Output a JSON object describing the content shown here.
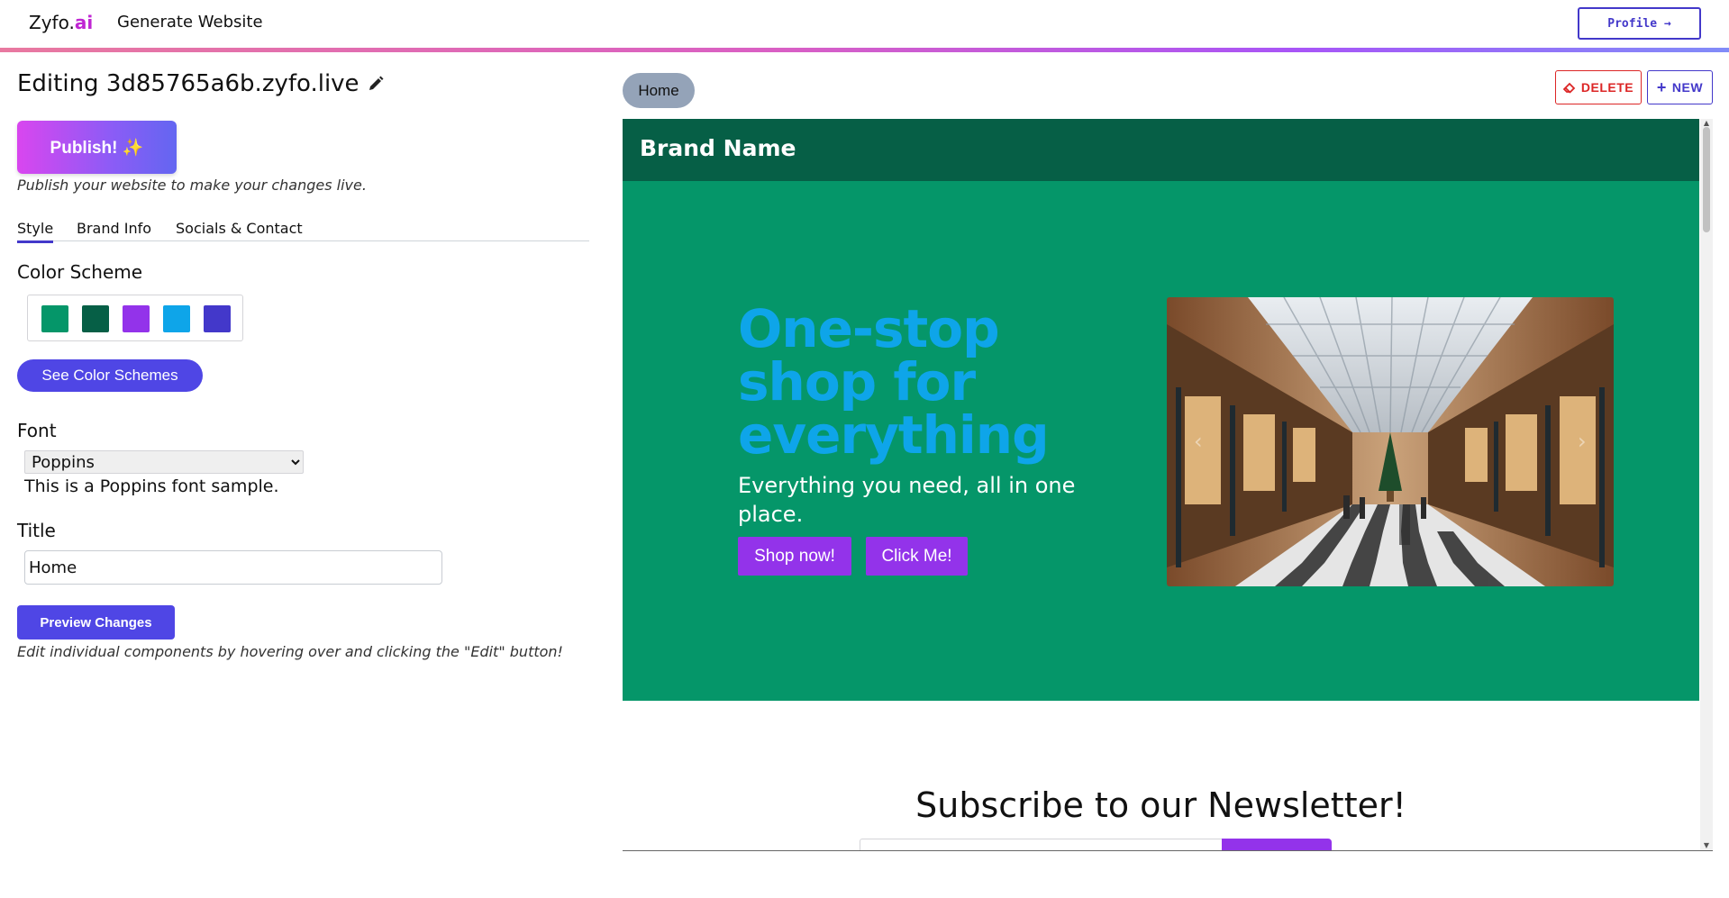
{
  "nav": {
    "logo_main": "Zyfo.",
    "logo_accent": "ai",
    "generate_link": "Generate Website",
    "profile_label": "Profile →"
  },
  "editor": {
    "title": "Editing 3d85765a6b.zyfo.live",
    "publish_label": "Publish! ✨",
    "publish_hint": "Publish your website to make your changes live.",
    "tabs": [
      "Style",
      "Brand Info",
      "Socials & Contact"
    ],
    "active_tab": "Style",
    "color_scheme_label": "Color Scheme",
    "color_scheme": [
      "#059669",
      "#065f46",
      "#9333ea",
      "#0ea5e9",
      "#4338ca"
    ],
    "see_schemes_label": "See Color Schemes",
    "font_label": "Font",
    "font_value": "Poppins",
    "font_sample": "This is a Poppins font sample.",
    "title_label": "Title",
    "title_value": "Home",
    "preview_label": "Preview Changes",
    "preview_hint": "Edit individual components by hovering over and clicking the \"Edit\" button!"
  },
  "pages": {
    "current": "Home",
    "delete_label": "DELETE",
    "new_label": "NEW"
  },
  "site": {
    "brand_name": "Brand Name",
    "hero_title": "One-stop shop for everything",
    "hero_subtitle": "Everything you need, all in one place.",
    "primary_cta": "Shop now!",
    "secondary_cta": "Click Me!",
    "carousel_prev": "‹",
    "carousel_next": "›",
    "newsletter_title": "Subscribe to our Newsletter!"
  }
}
